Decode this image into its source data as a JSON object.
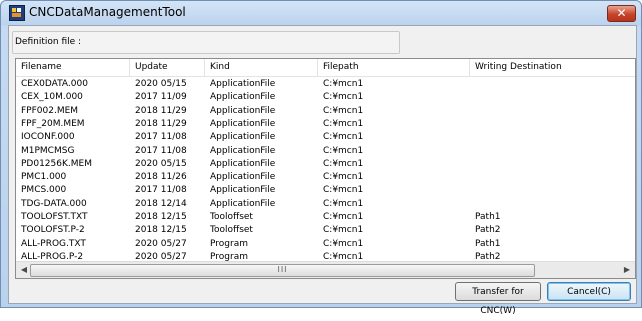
{
  "window": {
    "title": "CNCDataManagementTool",
    "close_symbol": "✕"
  },
  "definition": {
    "label": "Definition file :",
    "value": ""
  },
  "table": {
    "columns": [
      "Filename",
      "Update",
      "Kind",
      "Filepath",
      "Writing Destination"
    ],
    "rows": [
      [
        "CEX0DATA.000",
        "2020 05/15",
        "ApplicationFile",
        "C:¥mcn1",
        ""
      ],
      [
        "CEX_10M.000",
        "2017 11/09",
        "ApplicationFile",
        "C:¥mcn1",
        ""
      ],
      [
        "FPF002.MEM",
        "2018 11/29",
        "ApplicationFile",
        "C:¥mcn1",
        ""
      ],
      [
        "FPF_20M.MEM",
        "2018 11/29",
        "ApplicationFile",
        "C:¥mcn1",
        ""
      ],
      [
        "IOCONF.000",
        "2017 11/08",
        "ApplicationFile",
        "C:¥mcn1",
        ""
      ],
      [
        "M1PMCMSG",
        "2017 11/08",
        "ApplicationFile",
        "C:¥mcn1",
        ""
      ],
      [
        "PD01256K.MEM",
        "2020 05/15",
        "ApplicationFile",
        "C:¥mcn1",
        ""
      ],
      [
        "PMC1.000",
        "2018 11/26",
        "ApplicationFile",
        "C:¥mcn1",
        ""
      ],
      [
        "PMCS.000",
        "2017 11/08",
        "ApplicationFile",
        "C:¥mcn1",
        ""
      ],
      [
        "TDG-DATA.000",
        "2018 12/14",
        "ApplicationFile",
        "C:¥mcn1",
        ""
      ],
      [
        "TOOLOFST.TXT",
        "2018 12/15",
        "Tooloffset",
        "C:¥mcn1",
        "Path1"
      ],
      [
        "TOOLOFST.P-2",
        "2018 12/15",
        "Tooloffset",
        "C:¥mcn1",
        "Path2"
      ],
      [
        "ALL-PROG.TXT",
        "2020 05/27",
        "Program",
        "C:¥mcn1",
        "Path1"
      ],
      [
        "ALL-PROG.P-2",
        "2020 05/27",
        "Program",
        "C:¥mcn1",
        "Path2"
      ]
    ]
  },
  "scrollbar": {
    "left_arrow": "◀",
    "right_arrow": "▶",
    "grip": "III"
  },
  "buttons": {
    "transfer": "Transfer for CNC(W)",
    "cancel": "Cancel(C)"
  }
}
